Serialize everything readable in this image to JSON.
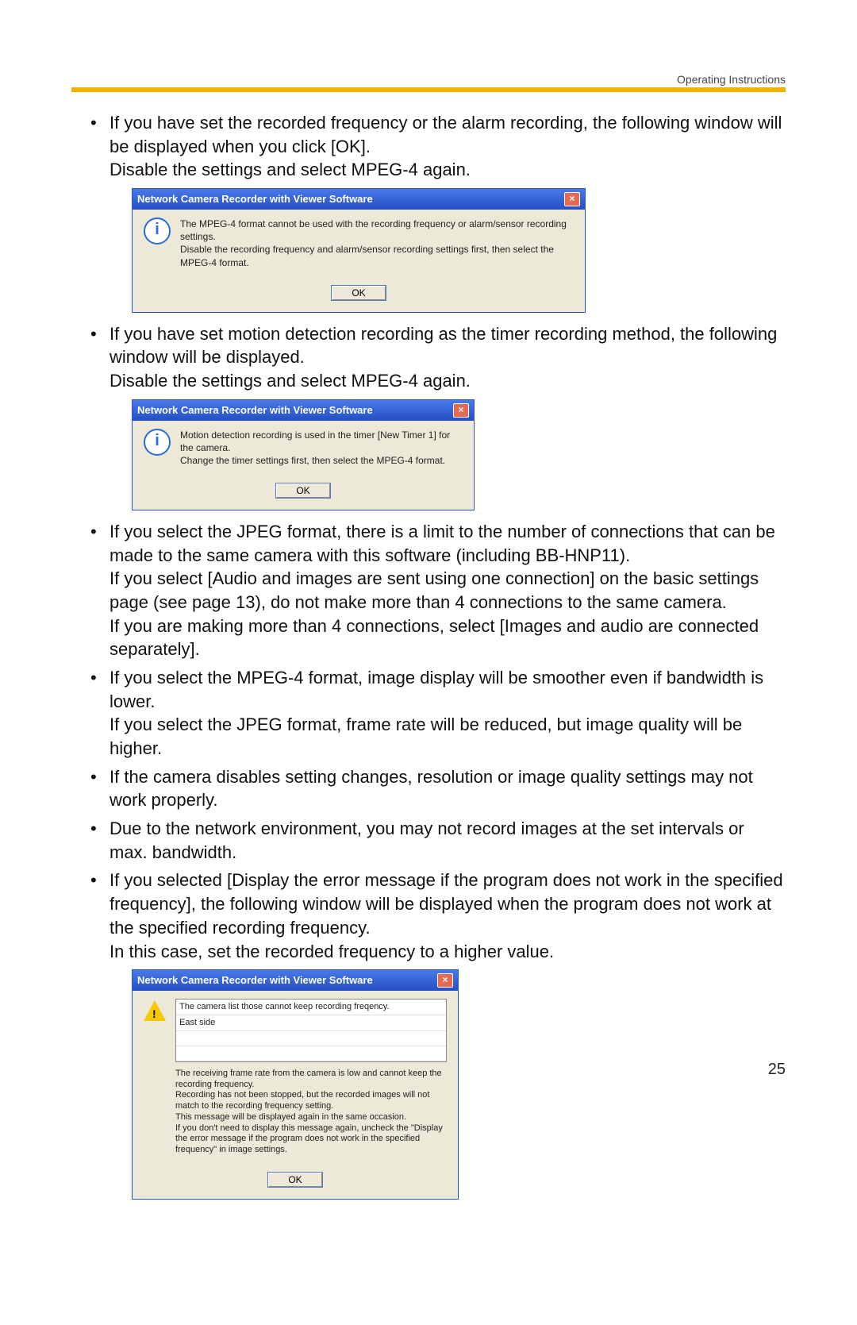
{
  "header": "Operating Instructions",
  "page_number": "25",
  "bullets": {
    "b1_a": "If you have set the recorded frequency or the alarm recording, the following window will be displayed when you click [OK].",
    "b1_b": "Disable the settings and select MPEG-4 again.",
    "b2_a": "If you have set motion detection recording as the timer recording method, the following window will be displayed.",
    "b2_b": "Disable the settings and select MPEG-4 again.",
    "b3_a": "If you select the JPEG format, there is a limit to the number of connections that can be made to the same camera with this software (including BB-HNP11).",
    "b3_b": "If you select [Audio and images are sent using one connection] on the basic settings page (see page 13), do not make more than 4 connections to the same camera.",
    "b3_c": "If you are making more than 4 connections, select [Images and audio are connected separately].",
    "b4_a": "If you select the MPEG-4 format, image display will be smoother even if bandwidth is lower.",
    "b4_b": "If you select the JPEG format, frame rate will be reduced, but image quality will be higher.",
    "b5": "If the camera disables setting changes, resolution or image quality settings may not work properly.",
    "b6": "Due to the network environment, you may not record images at the set intervals or max. bandwidth.",
    "b7_a": "If you selected [Display the error message if the program does not work in the specified frequency], the following window will be displayed when the program does not work at the specified recording frequency.",
    "b7_b": "In this case, set the recorded frequency to a higher value."
  },
  "dialog1": {
    "title": "Network Camera Recorder with Viewer Software",
    "msg1": "The MPEG-4 format cannot be used with the recording frequency or alarm/sensor recording settings.",
    "msg2": "Disable the recording frequency and alarm/sensor recording settings first, then select the MPEG-4 format.",
    "ok": "OK"
  },
  "dialog2": {
    "title": "Network Camera Recorder with Viewer Software",
    "msg1": "Motion detection recording is used in the timer [New Timer 1] for the camera.",
    "msg2": "Change the timer settings first, then select the MPEG-4 format.",
    "ok": "OK"
  },
  "dialog3": {
    "title": "Network Camera Recorder with Viewer Software",
    "row1": "The camera list those cannot keep recording freqency.",
    "row2": "East side",
    "note1": "The receiving frame rate from the camera is low and cannot keep the recording frequency.",
    "note2": "Recording has not been stopped, but the recorded images will not match to the recording frequency setting.",
    "note3": "This message will be displayed again in the same occasion.",
    "note4": "If you don't need to display this message again, uncheck the \"Display the error message if the program does not work in the specified frequency\" in image settings.",
    "ok": "OK"
  }
}
